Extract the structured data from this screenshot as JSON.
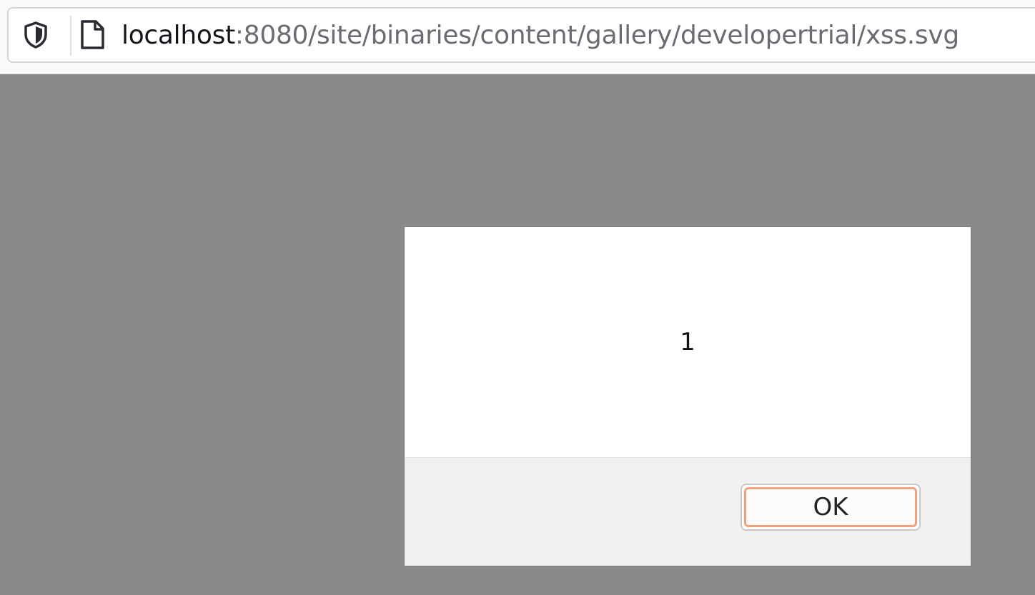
{
  "browser": {
    "url_host": "localhost",
    "url_rest": ":8080/site/binaries/content/gallery/developertrial/xss.svg",
    "icons": [
      "shield-icon",
      "page-icon"
    ]
  },
  "alert": {
    "message": "1",
    "ok_label": "OK"
  },
  "colors": {
    "page_background": "#8a8a8a",
    "focus_ring": "#f4a07c"
  }
}
